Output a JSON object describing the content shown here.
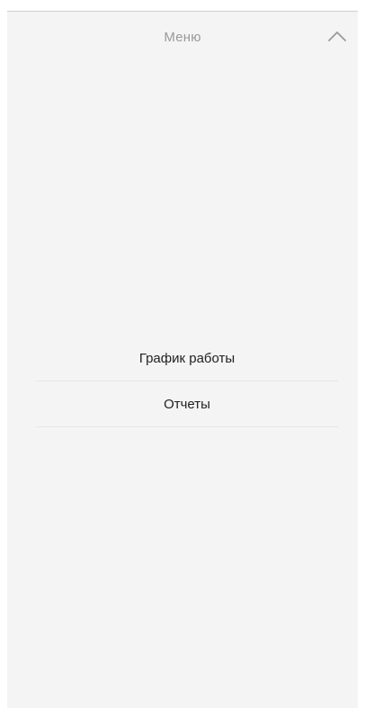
{
  "header": {
    "title": "Меню",
    "collapse_icon": "chevron-up-icon"
  },
  "menu": {
    "items": [
      {
        "label": "График работы"
      },
      {
        "label": "Отчеты"
      }
    ]
  },
  "colors": {
    "background": "#f4f4f4",
    "title": "#9a9a9a",
    "item_text": "#1f1f1f",
    "divider": "#e5e5e5"
  }
}
